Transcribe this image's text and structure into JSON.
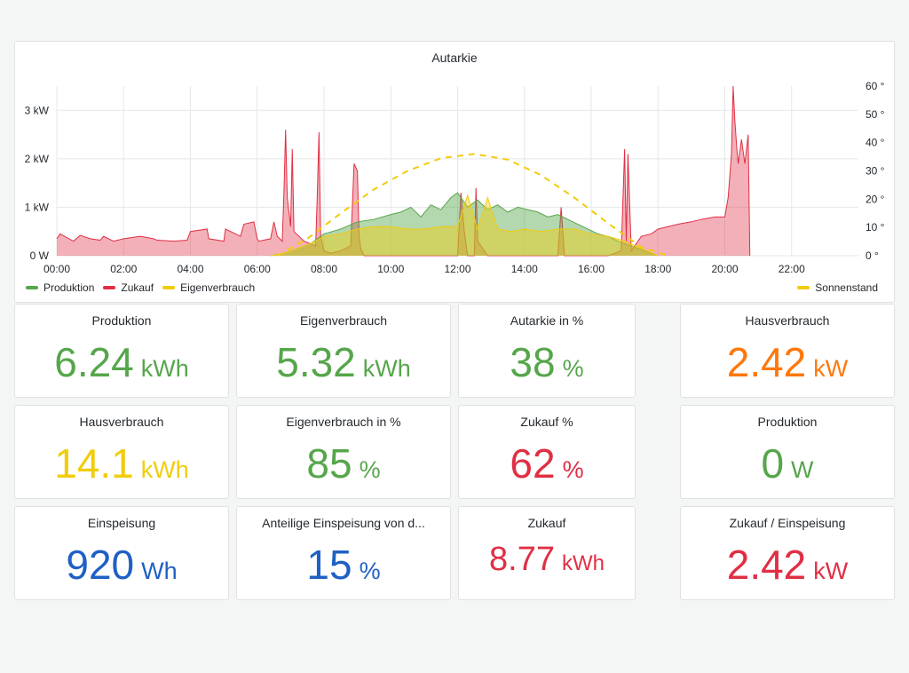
{
  "chart": {
    "title": "Autarkie",
    "legend_left": [
      {
        "name": "Produktion",
        "color": "#56a64b"
      },
      {
        "name": "Zukauf",
        "color": "#e02f44"
      },
      {
        "name": "Eigenverbrauch",
        "color": "#f2cc0c"
      }
    ],
    "legend_right": [
      {
        "name": "Sonnenstand",
        "color": "#f2cc0c"
      }
    ]
  },
  "chart_data": {
    "type": "area",
    "title": "Autarkie",
    "x_unit": "hour of day",
    "xlim": [
      0,
      24
    ],
    "x_ticks": [
      "00:00",
      "02:00",
      "04:00",
      "06:00",
      "08:00",
      "10:00",
      "12:00",
      "14:00",
      "16:00",
      "18:00",
      "20:00",
      "22:00"
    ],
    "y_left": {
      "ticks": [
        "0 W",
        "1 kW",
        "2 kW",
        "3 kW"
      ],
      "ylim": [
        0,
        3.5
      ],
      "unit": "kW"
    },
    "y_right": {
      "ticks": [
        "0 °",
        "10 °",
        "20 °",
        "30 °",
        "40 °",
        "50 °",
        "60 °"
      ],
      "ylim": [
        0,
        60
      ],
      "unit": "°"
    },
    "grid": true,
    "legend_placement": "bottom",
    "series": [
      {
        "name": "Zukauf",
        "color": "#e02f44",
        "axis": "left",
        "style": "area",
        "x": [
          0.0,
          0.1,
          0.5,
          0.7,
          1.0,
          1.3,
          1.4,
          1.7,
          2.0,
          2.5,
          2.9,
          3.0,
          3.5,
          3.9,
          4.0,
          4.5,
          4.55,
          5.0,
          5.05,
          5.5,
          5.6,
          5.9,
          6.0,
          6.05,
          6.4,
          6.5,
          6.6,
          6.75,
          6.8,
          6.85,
          6.9,
          7.0,
          7.05,
          7.1,
          7.4,
          7.75,
          7.8,
          7.85,
          7.9,
          8.0,
          8.2,
          8.5,
          8.8,
          8.9,
          9.0,
          9.05,
          9.1,
          9.2,
          12.0,
          12.1,
          12.2,
          12.3,
          12.5,
          12.55,
          12.6,
          12.9,
          13.0,
          13.1,
          15.0,
          15.1,
          15.2,
          16.0,
          16.5,
          16.9,
          17.0,
          17.05,
          17.1,
          17.2,
          17.5,
          17.8,
          18.0,
          18.3,
          18.6,
          19.0,
          19.3,
          19.7,
          20.0,
          20.1,
          20.2,
          20.25,
          20.3,
          20.35,
          20.4,
          20.5,
          20.6,
          20.7,
          20.75
        ],
        "y": [
          0.35,
          0.45,
          0.3,
          0.42,
          0.35,
          0.32,
          0.4,
          0.3,
          0.35,
          0.4,
          0.35,
          0.32,
          0.3,
          0.32,
          0.5,
          0.55,
          0.35,
          0.3,
          0.55,
          0.4,
          0.65,
          0.7,
          0.35,
          0.3,
          0.35,
          0.7,
          0.4,
          0.3,
          1.3,
          2.6,
          1.2,
          0.6,
          2.2,
          0.5,
          0.3,
          0.2,
          1.3,
          2.55,
          0.4,
          0.1,
          0.05,
          0.1,
          0.2,
          1.9,
          1.75,
          0.4,
          0.15,
          0.0,
          0.0,
          1.3,
          0.5,
          0.0,
          0.0,
          1.4,
          0.3,
          0.0,
          0.0,
          0.0,
          0.0,
          1.0,
          0.0,
          0.0,
          0.0,
          0.1,
          2.2,
          0.3,
          2.1,
          0.1,
          0.4,
          0.45,
          0.55,
          0.6,
          0.65,
          0.7,
          0.75,
          0.8,
          0.8,
          1.2,
          2.1,
          3.5,
          2.8,
          2.3,
          1.9,
          2.4,
          1.9,
          2.5,
          0.0
        ]
      },
      {
        "name": "Produktion",
        "color": "#56a64b",
        "axis": "left",
        "style": "area",
        "x": [
          6.4,
          6.8,
          7.2,
          7.6,
          8.0,
          8.5,
          9.0,
          9.5,
          10.0,
          10.3,
          10.6,
          10.9,
          11.2,
          11.5,
          11.8,
          12.0,
          12.3,
          12.6,
          12.9,
          13.2,
          13.5,
          13.8,
          14.1,
          14.4,
          14.7,
          15.0,
          15.3,
          15.6,
          15.9,
          16.2,
          16.5,
          16.8,
          17.2,
          17.6,
          18.0
        ],
        "y": [
          0.0,
          0.05,
          0.15,
          0.25,
          0.45,
          0.55,
          0.7,
          0.75,
          0.85,
          0.9,
          1.0,
          0.8,
          1.05,
          0.95,
          1.2,
          1.3,
          1.0,
          1.15,
          0.95,
          1.05,
          0.9,
          1.0,
          0.95,
          0.9,
          0.8,
          0.85,
          0.75,
          0.65,
          0.55,
          0.45,
          0.4,
          0.3,
          0.2,
          0.1,
          0.0
        ]
      },
      {
        "name": "Eigenverbrauch",
        "color": "#f2cc0c",
        "axis": "left",
        "style": "area",
        "x": [
          6.4,
          6.8,
          7.2,
          7.6,
          8.0,
          8.5,
          9.0,
          9.5,
          10.0,
          10.5,
          11.0,
          11.5,
          12.0,
          12.3,
          12.6,
          12.9,
          13.2,
          13.6,
          14.0,
          14.5,
          15.0,
          15.5,
          16.0,
          16.5,
          17.0,
          17.5,
          18.0
        ],
        "y": [
          0.0,
          0.05,
          0.15,
          0.25,
          0.4,
          0.45,
          0.55,
          0.6,
          0.6,
          0.55,
          0.55,
          0.6,
          0.6,
          1.25,
          0.55,
          1.2,
          0.55,
          0.5,
          0.55,
          0.5,
          0.55,
          0.55,
          0.45,
          0.4,
          0.3,
          0.15,
          0.0
        ]
      },
      {
        "name": "Sonnenstand",
        "color": "#f2cc0c",
        "axis": "right",
        "style": "dashed-line",
        "x": [
          6.6,
          7.5,
          8.5,
          9.5,
          10.5,
          11.5,
          12.5,
          13.5,
          14.5,
          15.5,
          16.5,
          17.5,
          18.3
        ],
        "y": [
          0,
          6,
          15,
          23.5,
          30,
          34.5,
          36,
          34,
          28.5,
          20.5,
          11.5,
          3,
          0
        ]
      }
    ]
  },
  "stats": {
    "produktion_energy": {
      "title": "Produktion",
      "value": "6.24",
      "unit": "kWh",
      "color": "#56a64b"
    },
    "eigenverbrauch_energy": {
      "title": "Eigenverbrauch",
      "value": "5.32",
      "unit": "kWh",
      "color": "#56a64b"
    },
    "autarkie_pct": {
      "title": "Autarkie in %",
      "value": "38",
      "unit": "%",
      "color": "#56a64b"
    },
    "hausverbrauch_power": {
      "title": "Hausverbrauch",
      "value": "2.42",
      "unit": "kW",
      "color": "#ff780a"
    },
    "hausverbrauch_energy": {
      "title": "Hausverbrauch",
      "value": "14.1",
      "unit": "kWh",
      "color": "#f2cc0c"
    },
    "eigenverbrauch_pct": {
      "title": "Eigenverbrauch in %",
      "value": "85",
      "unit": "%",
      "color": "#56a64b"
    },
    "zukauf_pct": {
      "title": "Zukauf %",
      "value": "62",
      "unit": "%",
      "color": "#e02f44"
    },
    "produktion_power": {
      "title": "Produktion",
      "value": "0",
      "unit": "W",
      "color": "#56a64b"
    },
    "einspeisung_energy": {
      "title": "Einspeisung",
      "value": "920",
      "unit": "Wh",
      "color": "#1f60c4"
    },
    "anteilige_einspeisung_pct": {
      "title": "Anteilige Einspeisung von d...",
      "value": "15",
      "unit": "%",
      "color": "#1f60c4"
    },
    "zukauf_energy": {
      "title": "Zukauf",
      "value": "8.77",
      "unit": "kWh",
      "color": "#e02f44"
    },
    "zukauf_einspeisung_power": {
      "title": "Zukauf / Einspeisung",
      "value": "2.42",
      "unit": "kW",
      "color": "#e02f44"
    }
  }
}
